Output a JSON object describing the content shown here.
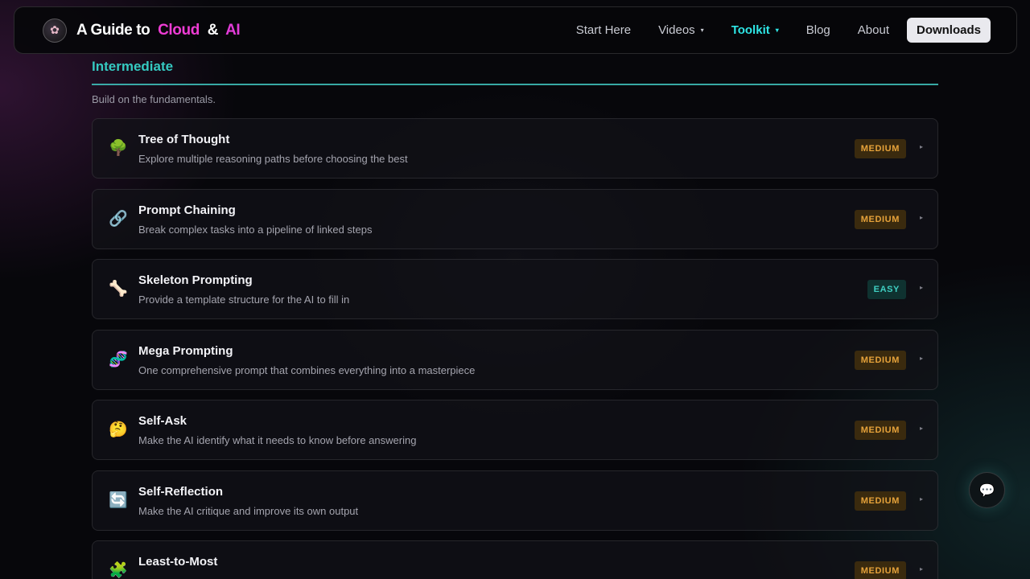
{
  "brand": {
    "logo_icon": "lotus-icon",
    "title_prefix": "A Guide to",
    "title_cloud": "Cloud",
    "title_amp": "&",
    "title_ai": "AI"
  },
  "nav": {
    "start_here": "Start Here",
    "videos": "Videos",
    "toolkit": "Toolkit",
    "blog": "Blog",
    "about": "About",
    "downloads": "Downloads",
    "caret_icon": "▾"
  },
  "section": {
    "title": "Intermediate",
    "subtitle": "Build on the fundamentals."
  },
  "techniques": [
    {
      "icon": "tree-icon",
      "glyph": "🌳",
      "title": "Tree of Thought",
      "desc": "Explore multiple reasoning paths before choosing the best",
      "difficulty": "MEDIUM"
    },
    {
      "icon": "link-icon",
      "glyph": "🔗",
      "title": "Prompt Chaining",
      "desc": "Break complex tasks into a pipeline of linked steps",
      "difficulty": "MEDIUM"
    },
    {
      "icon": "bone-icon",
      "glyph": "🦴",
      "title": "Skeleton Prompting",
      "desc": "Provide a template structure for the AI to fill in",
      "difficulty": "EASY"
    },
    {
      "icon": "dna-icon",
      "glyph": "🧬",
      "title": "Mega Prompting",
      "desc": "One comprehensive prompt that combines everything into a masterpiece",
      "difficulty": "MEDIUM"
    },
    {
      "icon": "thinking-face-icon",
      "glyph": "🤔",
      "title": "Self-Ask",
      "desc": "Make the AI identify what it needs to know before answering",
      "difficulty": "MEDIUM"
    },
    {
      "icon": "repeat-arrows-icon",
      "glyph": "🔄",
      "title": "Self-Reflection",
      "desc": "Make the AI critique and improve its own output",
      "difficulty": "MEDIUM"
    },
    {
      "icon": "puzzle-icon",
      "glyph": "🧩",
      "title": "Least-to-Most",
      "desc": "",
      "difficulty": "MEDIUM"
    }
  ],
  "card_arrow": "▸",
  "chat": {
    "icon": "chat-bubble-icon",
    "glyph": "💬"
  },
  "colors": {
    "accent_teal": "#35c9c1",
    "brand_pink": "#ee3cd4",
    "medium_badge": "#e6a23a",
    "easy_badge": "#3fcfc2"
  }
}
